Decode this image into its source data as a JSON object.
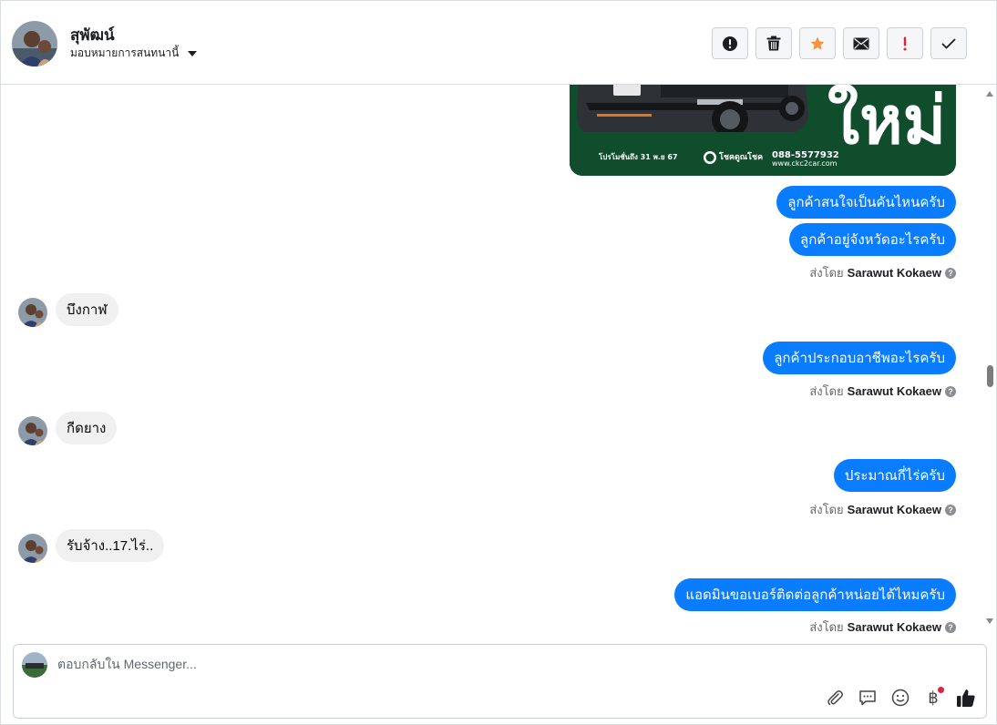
{
  "header": {
    "user_name": "สุพัฒน์",
    "assign_label": "มอบหมายการสนทนานี้",
    "actions": [
      {
        "icon": "alert-circle-icon"
      },
      {
        "icon": "trash-icon"
      },
      {
        "icon": "star-icon",
        "color": "#f7923b"
      },
      {
        "icon": "envelope-icon"
      },
      {
        "icon": "exclamation-icon",
        "color": "#e41e3f"
      },
      {
        "icon": "check-icon"
      }
    ]
  },
  "promo": {
    "headline": "ใหม่",
    "promo_text": "โปรโมชั่นถึง 31 พ.ย 67",
    "brand": "โชคดูณโชค",
    "phone": "088-5577932",
    "website": "www.ckc2car.com"
  },
  "thread": {
    "sent_by_prefix": "ส่งโดย",
    "sender": "Sarawut Kokaew",
    "messages": [
      {
        "dir": "out",
        "text": "ลูกค้าสนใจเป็นคันไหนครับ"
      },
      {
        "dir": "out",
        "text": "ลูกค้าอยู่จังหวัดอะไรครับ"
      },
      {
        "dir": "in",
        "text": "บึงกาฬ"
      },
      {
        "dir": "out",
        "text": "ลูกค้าประกอบอาชีพอะไรครับ"
      },
      {
        "dir": "in",
        "text": "กีดยาง"
      },
      {
        "dir": "out",
        "text": "ประมาณกี่ไร่ครับ"
      },
      {
        "dir": "in",
        "text": "รับจ้าง..17.ไร่.."
      },
      {
        "dir": "out",
        "text": "แอดมินขอเบอร์ติดต่อลูกค้าหน่อยได้ไหมครับ"
      }
    ]
  },
  "composer": {
    "placeholder": "ตอบกลับใน Messenger...",
    "currency_symbol": "฿",
    "tools": [
      "paperclip-icon",
      "saved-reply-icon",
      "emoji-icon",
      "baht-icon",
      "thumbs-up-icon"
    ]
  },
  "colors": {
    "outgoing_bubble": "#0a7cff",
    "incoming_bubble": "#f0f0f0",
    "promo_green": "#0f4d2c"
  }
}
